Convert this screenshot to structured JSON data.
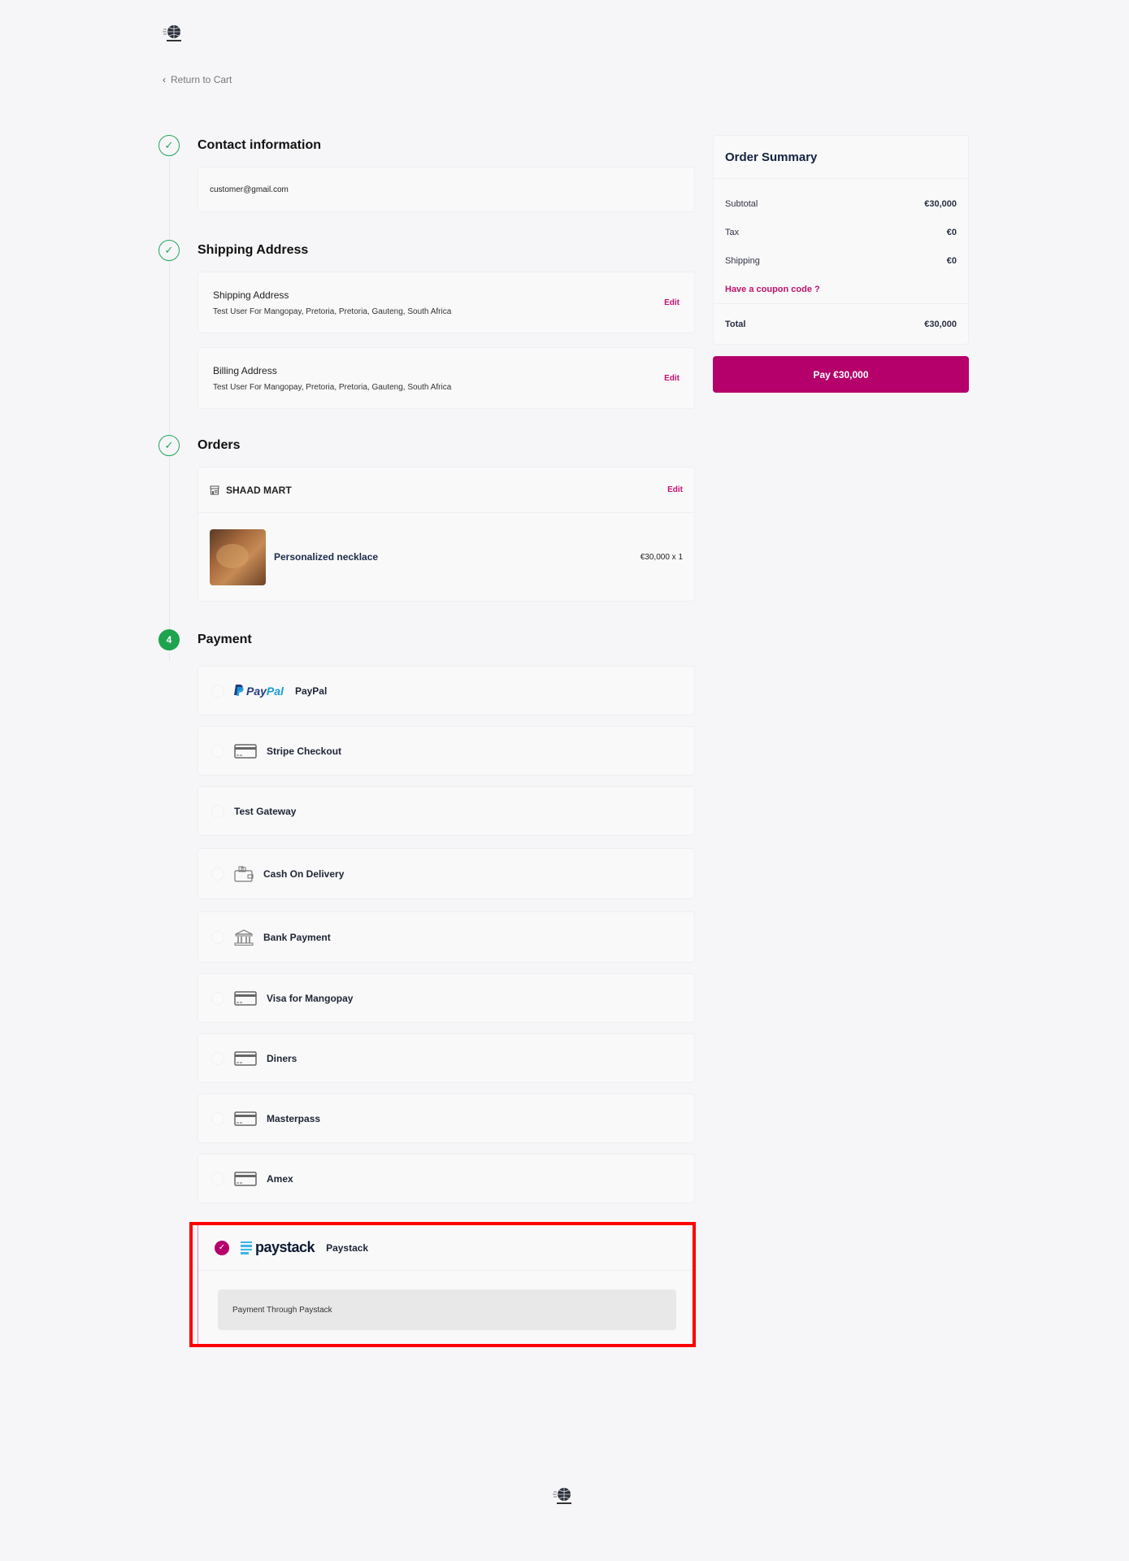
{
  "header": {
    "back_link": "Return to Cart"
  },
  "steps": {
    "contact": {
      "title": "Contact information",
      "email": "customer@gmail.com"
    },
    "shipping": {
      "title": "Shipping Address",
      "shipping_address": {
        "label": "Shipping Address",
        "value": "Test User For Mangopay, Pretoria, Pretoria, Gauteng, South Africa",
        "edit": "Edit"
      },
      "billing_address": {
        "label": "Billing Address",
        "value": "Test User For Mangopay, Pretoria, Pretoria, Gauteng, South Africa",
        "edit": "Edit"
      }
    },
    "orders": {
      "title": "Orders",
      "store_name": "SHAAD MART",
      "edit": "Edit",
      "items": [
        {
          "name": "Personalized necklace",
          "price": "€30,000 x 1"
        }
      ]
    },
    "payment": {
      "step_number": "4",
      "title": "Payment",
      "methods": [
        {
          "label": "PayPal",
          "icon": "paypal-logo"
        },
        {
          "label": "Stripe Checkout",
          "icon": "credit-card-icon"
        },
        {
          "label": "Test Gateway",
          "icon": ""
        },
        {
          "label": "Cash On Delivery",
          "icon": "wallet-icon"
        },
        {
          "label": "Bank Payment",
          "icon": "bank-icon"
        },
        {
          "label": "Visa for Mangopay",
          "icon": "credit-card-icon"
        },
        {
          "label": "Diners",
          "icon": "credit-card-icon"
        },
        {
          "label": "Masterpass",
          "icon": "credit-card-icon"
        },
        {
          "label": "Amex",
          "icon": "credit-card-icon"
        }
      ],
      "selected": {
        "label": "Paystack",
        "logo_text": "paystack",
        "description": "Payment Through Paystack"
      },
      "paypal_logo": {
        "pay": "Pay",
        "pal": "Pal"
      }
    }
  },
  "summary": {
    "title": "Order Summary",
    "subtotal_label": "Subtotal",
    "subtotal": "€30,000",
    "tax_label": "Tax",
    "tax": "€0",
    "shipping_label": "Shipping",
    "shipping": "€0",
    "coupon": "Have a coupon code ?",
    "total_label": "Total",
    "total": "€30,000",
    "pay_button": "Pay €30,000"
  },
  "colors": {
    "accent": "#b5006b",
    "success": "#1ea34f",
    "highlight": "#ff0000"
  }
}
